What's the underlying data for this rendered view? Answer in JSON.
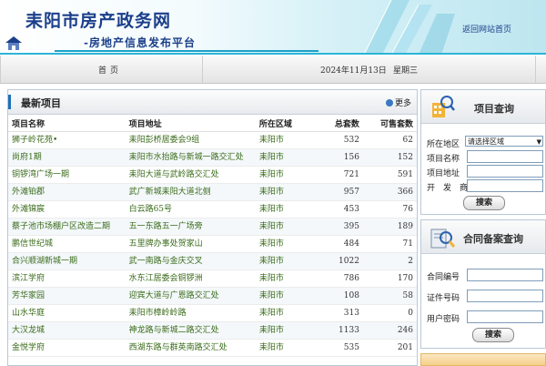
{
  "header": {
    "site_title": "耒阳市房产政务网",
    "subtitle": "-房地产信息发布平台",
    "home_link": "返回网站首页"
  },
  "nav": {
    "home": "首页",
    "date": "2024年11月13日",
    "weekday": "星期三"
  },
  "projects": {
    "title": "最新项目",
    "more": "更多",
    "columns": [
      "项目名称",
      "项目地址",
      "所在区域",
      "总套数",
      "可售套数"
    ],
    "rows": [
      {
        "name": "狮子岭花苑•",
        "address": "耒阳彭桥居委会9组",
        "area": "耒阳市",
        "total": "532",
        "available": "62"
      },
      {
        "name": "尚府1期",
        "address": "耒阳市水抬路与新城一路交汇处",
        "area": "耒阳市",
        "total": "156",
        "available": "152"
      },
      {
        "name": "铜锣湾广场一期",
        "address": "耒阳大道与武岭路交汇处",
        "area": "耒阳市",
        "total": "721",
        "available": "591"
      },
      {
        "name": "外滩铂郡",
        "address": "武广新城耒阳大道北侧",
        "area": "耒阳市",
        "total": "957",
        "available": "366"
      },
      {
        "name": "外滩锦宸",
        "address": "白云路65号",
        "area": "耒阳市",
        "total": "453",
        "available": "76"
      },
      {
        "name": "蔡子池市场棚户区改造二期",
        "address": "五一东路五一广场旁",
        "area": "耒阳市",
        "total": "395",
        "available": "189"
      },
      {
        "name": "鹏信世纪城",
        "address": "五里牌办事处贺家山",
        "area": "耒阳市",
        "total": "484",
        "available": "71"
      },
      {
        "name": "合兴顺湖新城一期",
        "address": "武一南路与金庆交叉",
        "area": "耒阳市",
        "total": "1022",
        "available": "2"
      },
      {
        "name": "滨江学府",
        "address": "水东江居委会铜锣洲",
        "area": "耒阳市",
        "total": "786",
        "available": "170"
      },
      {
        "name": "芳华家园",
        "address": "迎宾大道与广恩路交汇处",
        "area": "耒阳市",
        "total": "108",
        "available": "58"
      },
      {
        "name": "山水华庭",
        "address": "耒阳市樟岭岭路",
        "area": "耒阳市",
        "total": "313",
        "available": "0"
      },
      {
        "name": "大汉龙城",
        "address": "神龙路与新城二路交汇处",
        "area": "耒阳市",
        "total": "1133",
        "available": "246"
      },
      {
        "name": "金悦学府",
        "address": "西湖东路与群英南路交汇处",
        "area": "耒阳市",
        "total": "535",
        "available": "201"
      }
    ]
  },
  "project_query": {
    "title": "项目查询",
    "region_label": "所在地区",
    "region_value": "请选择区域",
    "name_label": "项目名称",
    "address_label": "项目地址",
    "developer_label": "开发商",
    "search_button": "搜索"
  },
  "contract_query": {
    "title": "合同备案查询",
    "contract_label": "合同编号",
    "cert_label": "证件号码",
    "password_label": "用户密码",
    "search_button": "搜索"
  },
  "colors": {
    "brand_blue": "#1b3f8a",
    "accent_cyan": "#2bb4d6",
    "table_text_green": "#3a6b1a"
  }
}
